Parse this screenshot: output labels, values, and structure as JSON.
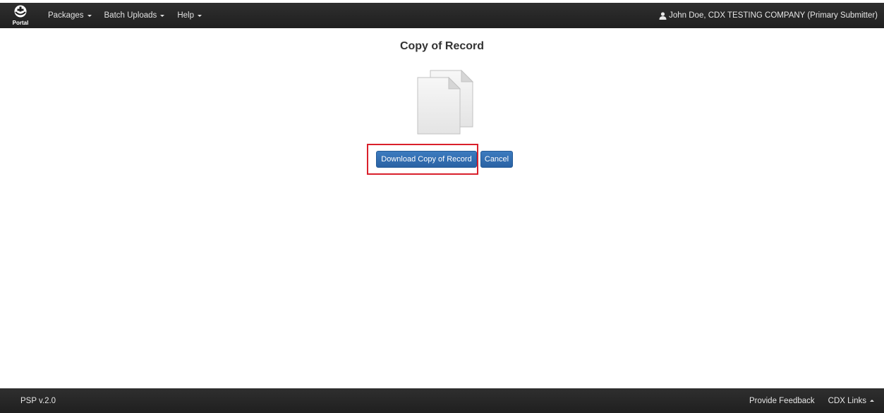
{
  "navbar": {
    "brand_text": "Portal",
    "menu": [
      {
        "label": "Packages"
      },
      {
        "label": "Batch Uploads"
      },
      {
        "label": "Help"
      }
    ],
    "user": "John Doe, CDX TESTING COMPANY (Primary Submitter)",
    "user_icon": "user-icon"
  },
  "main": {
    "title": "Copy of Record",
    "icon": "document-copies-icon",
    "download_label": "Download Copy of Record",
    "cancel_label": "Cancel",
    "highlight_color": "#d9202b",
    "button_color": "#2f6db1"
  },
  "footer": {
    "version": "PSP  v.2.0",
    "feedback_label": "Provide Feedback",
    "links_label": "CDX Links"
  }
}
